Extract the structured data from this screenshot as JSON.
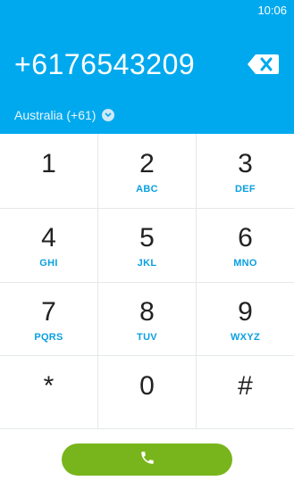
{
  "status_bar": {
    "time": "10:06"
  },
  "dialer": {
    "number": "+6176543209",
    "country": "Australia (+61)",
    "backspace_icon": "backspace-icon",
    "call_icon": "phone-icon"
  },
  "keys": [
    {
      "digit": "1",
      "letters": ""
    },
    {
      "digit": "2",
      "letters": "ABC"
    },
    {
      "digit": "3",
      "letters": "DEF"
    },
    {
      "digit": "4",
      "letters": "GHI"
    },
    {
      "digit": "5",
      "letters": "JKL"
    },
    {
      "digit": "6",
      "letters": "MNO"
    },
    {
      "digit": "7",
      "letters": "PQRS"
    },
    {
      "digit": "8",
      "letters": "TUV"
    },
    {
      "digit": "9",
      "letters": "WXYZ"
    },
    {
      "digit": "*",
      "letters": ""
    },
    {
      "digit": "0",
      "letters": ""
    },
    {
      "digit": "#",
      "letters": ""
    }
  ],
  "colors": {
    "header": "#00a9ee",
    "accent_letters": "#0aa0e0",
    "call_button": "#78b51c"
  }
}
